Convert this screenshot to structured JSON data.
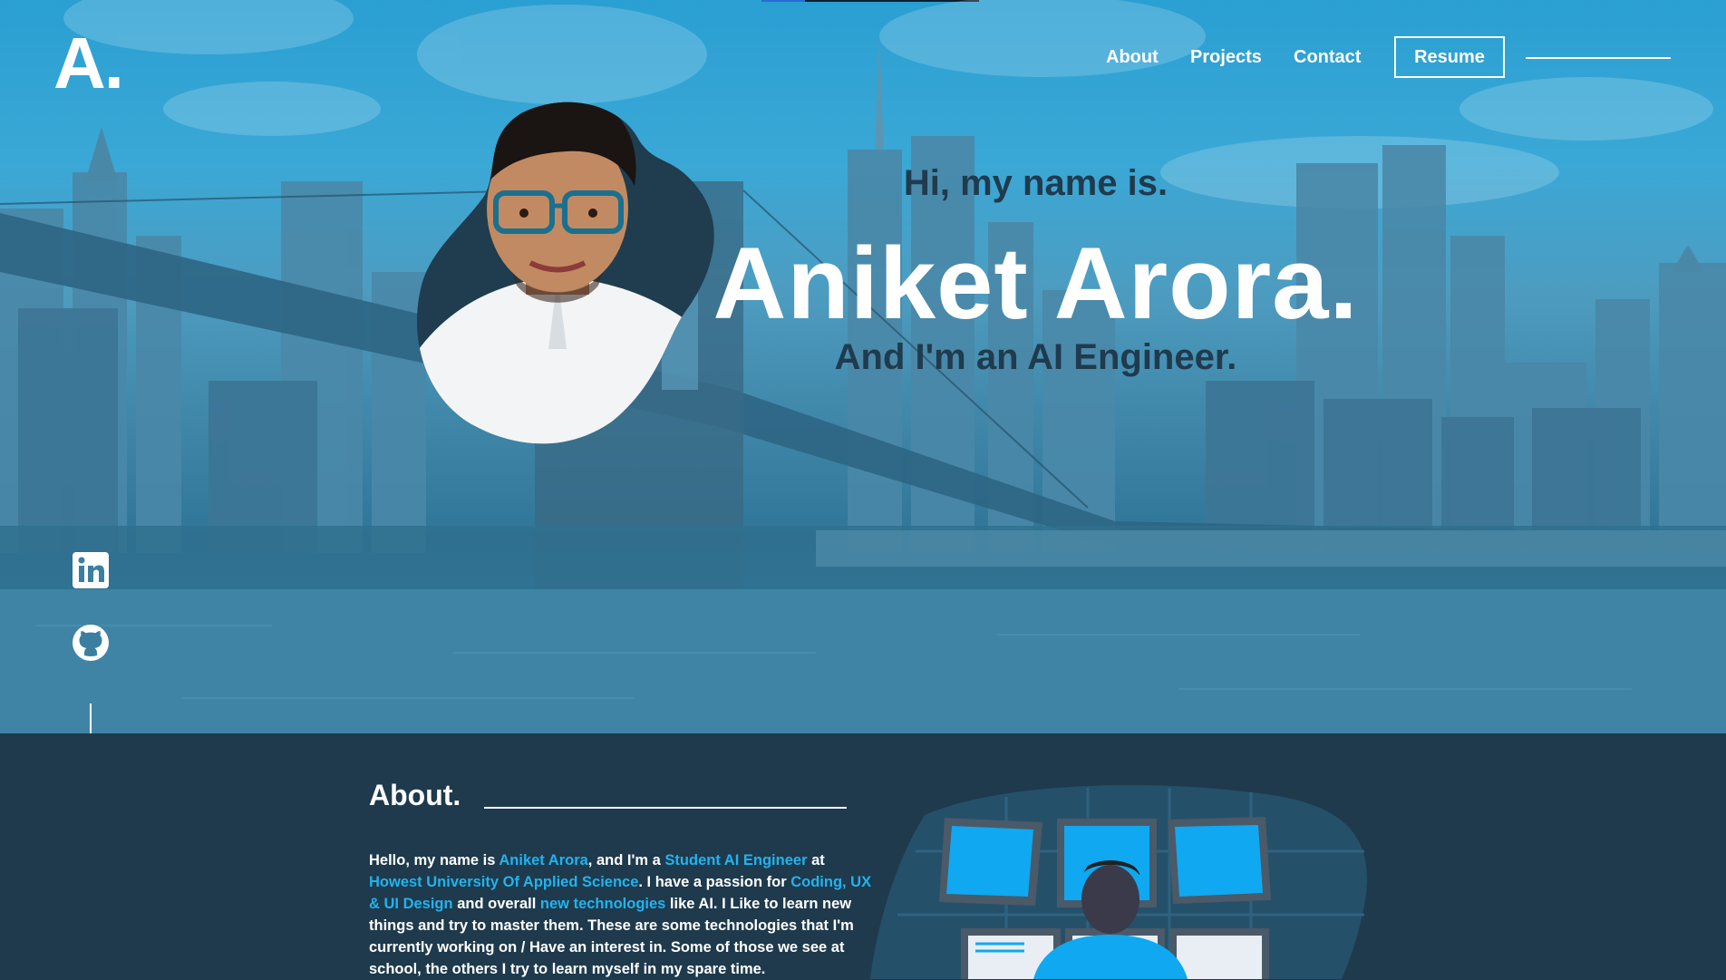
{
  "brand": {
    "logo_text": "A."
  },
  "nav": {
    "about": "About",
    "projects": "Projects",
    "contact": "Contact",
    "resume": "Resume"
  },
  "hero": {
    "greeting": "Hi, my name is.",
    "name": "Aniket Arora.",
    "role": "And I'm an AI Engineer."
  },
  "social": {
    "linkedin_icon": "linkedin-icon",
    "github_icon": "github-icon"
  },
  "about": {
    "title": "About.",
    "p1": "Hello, my name is ",
    "name_hl": "Aniket Arora",
    "p2": ", and I'm a ",
    "role_hl": "Student AI Engineer",
    "p3": " at ",
    "school_hl": "Howest University Of Applied Science",
    "p4": ". I have a passion for ",
    "passion_hl": "Coding, UX & UI Design",
    "p5": " and overall ",
    "tech_hl": "new technologies",
    "p6": " like AI. I Like to learn new things and try to master them. These are some technologies that I'm currently working on / Have an interest in. Some of those we see at school, the others I try to learn myself in my spare time."
  },
  "colors": {
    "accent": "#21b3ef",
    "dark_navy": "#1e3a4c",
    "hero_sky": "#2a9fd2"
  }
}
